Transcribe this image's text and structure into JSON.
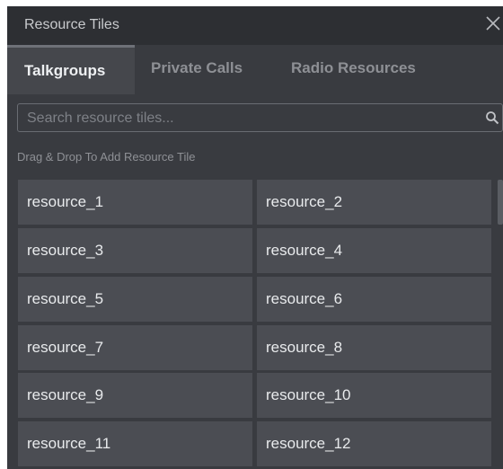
{
  "window": {
    "title": "Resource Tiles"
  },
  "tabs": [
    {
      "label": "Talkgroups",
      "active": true
    },
    {
      "label": "Private Calls",
      "active": false
    },
    {
      "label": "Radio Resources",
      "active": false
    }
  ],
  "search": {
    "placeholder": "Search resource tiles...",
    "value": ""
  },
  "hint": "Drag & Drop To Add Resource Tile",
  "tiles": [
    "resource_1",
    "resource_2",
    "resource_3",
    "resource_4",
    "resource_5",
    "resource_6",
    "resource_7",
    "resource_8",
    "resource_9",
    "resource_10",
    "resource_11",
    "resource_12"
  ],
  "icons": {
    "close": "close-icon",
    "search": "search-icon"
  },
  "colors": {
    "panel_bg": "#393b40",
    "titlebar_bg": "#2d2f33",
    "tile_bg": "#4b4d53",
    "active_tab_bg": "#45474c"
  }
}
